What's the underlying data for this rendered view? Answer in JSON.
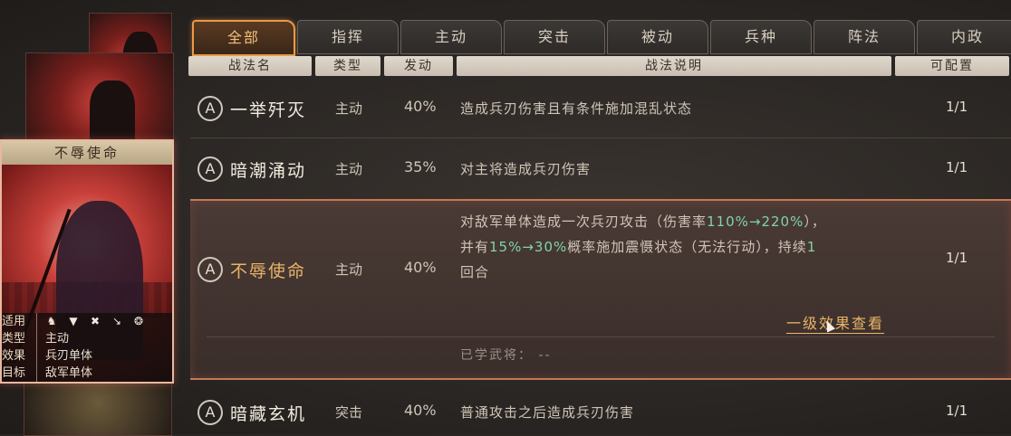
{
  "tabs": [
    "全部",
    "指挥",
    "主动",
    "突击",
    "被动",
    "兵种",
    "阵法",
    "内政"
  ],
  "active_tab": 0,
  "headers": [
    "战法名",
    "类型",
    "发动",
    "战法说明",
    "可配置"
  ],
  "card": {
    "title": "不辱使命",
    "rows": [
      {
        "key": "适用",
        "value": ""
      },
      {
        "key": "类型",
        "value": "主动"
      },
      {
        "key": "效果",
        "value": "兵刃单体"
      },
      {
        "key": "目标",
        "value": "敌军单体"
      }
    ],
    "icons": [
      "cavalry-icon",
      "shield-icon",
      "bow-icon",
      "spear-icon",
      "wheel-icon"
    ]
  },
  "skills": [
    {
      "grade": "A",
      "name": "一举歼灭",
      "type": "主动",
      "rate": "40%",
      "desc": "造成兵刃伤害且有条件施加混乱状态",
      "count": "1/1"
    },
    {
      "grade": "A",
      "name": "暗潮涌动",
      "type": "主动",
      "rate": "35%",
      "desc": "对主将造成兵刃伤害",
      "count": "1/1"
    },
    {
      "grade": "A",
      "name": "不辱使命",
      "type": "主动",
      "rate": "40%",
      "desc_l1a": "对敌军单体造成一次兵刃攻击（伤害率",
      "desc_l1g": "110%→220%",
      "desc_l1b": "），",
      "desc_l2a": "并有",
      "desc_l2g": "15%→30%",
      "desc_l2b": "概率施加震慑状态（无法行动），持续",
      "desc_l2c": "1",
      "desc_l3": "回合",
      "count": "1/1",
      "link": "一级效果查看",
      "learned": "已学武将：  --"
    },
    {
      "grade": "A",
      "name": "暗藏玄机",
      "type": "突击",
      "rate": "40%",
      "desc": "普通攻击之后造成兵刃伤害",
      "count": "1/1"
    }
  ]
}
